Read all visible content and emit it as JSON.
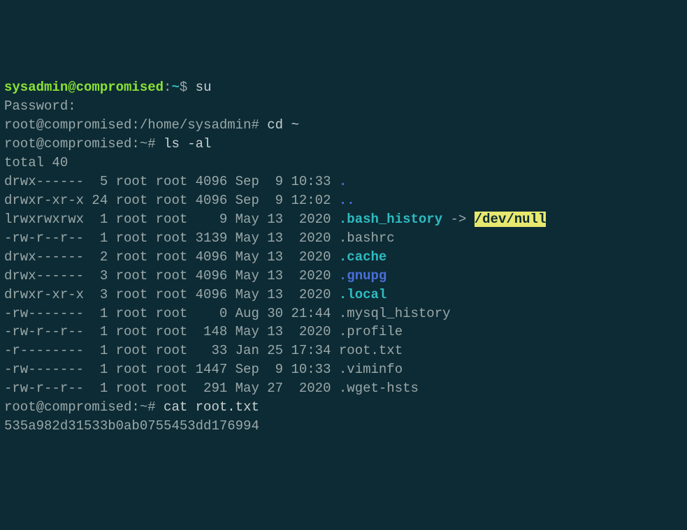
{
  "line1": {
    "prompt_user": "sysadmin@compromised",
    "colon": ":",
    "path": "~",
    "sep": "$ ",
    "cmd": "su"
  },
  "line2": "Password:",
  "line3": {
    "prompt": "root@compromised:/home/sysadmin# ",
    "cmd": "cd ~"
  },
  "line4": {
    "prompt": "root@compromised:~# ",
    "cmd": "ls -al"
  },
  "total": "total 40",
  "rows": [
    {
      "perm": "drwx------  5 root root 4096 Sep  9 10:33 ",
      "name": ".",
      "cls": "dir"
    },
    {
      "perm": "drwxr-xr-x 24 root root 4096 Sep  9 12:02 ",
      "name": "..",
      "cls": "dir"
    },
    {
      "perm": "lrwxrwxrwx  1 root root    9 May 13  2020 ",
      "name": ".bash_history",
      "cls": "link",
      "arrow": " -> ",
      "target": "/dev/null"
    },
    {
      "perm": "-rw-r--r--  1 root root 3139 May 13  2020 ",
      "name": ".bashrc",
      "cls": ""
    },
    {
      "perm": "drwx------  2 root root 4096 May 13  2020 ",
      "name": ".cache",
      "cls": "dir-other"
    },
    {
      "perm": "drwx------  3 root root 4096 May 13  2020 ",
      "name": ".gnupg",
      "cls": "dir"
    },
    {
      "perm": "drwxr-xr-x  3 root root 4096 May 13  2020 ",
      "name": ".local",
      "cls": "dir-other"
    },
    {
      "perm": "-rw-------  1 root root    0 Aug 30 21:44 ",
      "name": ".mysql_history",
      "cls": ""
    },
    {
      "perm": "-rw-r--r--  1 root root  148 May 13  2020 ",
      "name": ".profile",
      "cls": ""
    },
    {
      "perm": "-r--------  1 root root   33 Jan 25 17:34 ",
      "name": "root.txt",
      "cls": ""
    },
    {
      "perm": "-rw-------  1 root root 1447 Sep  9 10:33 ",
      "name": ".viminfo",
      "cls": ""
    },
    {
      "perm": "-rw-r--r--  1 root root  291 May 27  2020 ",
      "name": ".wget-hsts",
      "cls": ""
    }
  ],
  "line_cat": {
    "prompt": "root@compromised:~# ",
    "cmd": "cat root.txt"
  },
  "flag": "535a982d31533b0ab0755453dd176994"
}
